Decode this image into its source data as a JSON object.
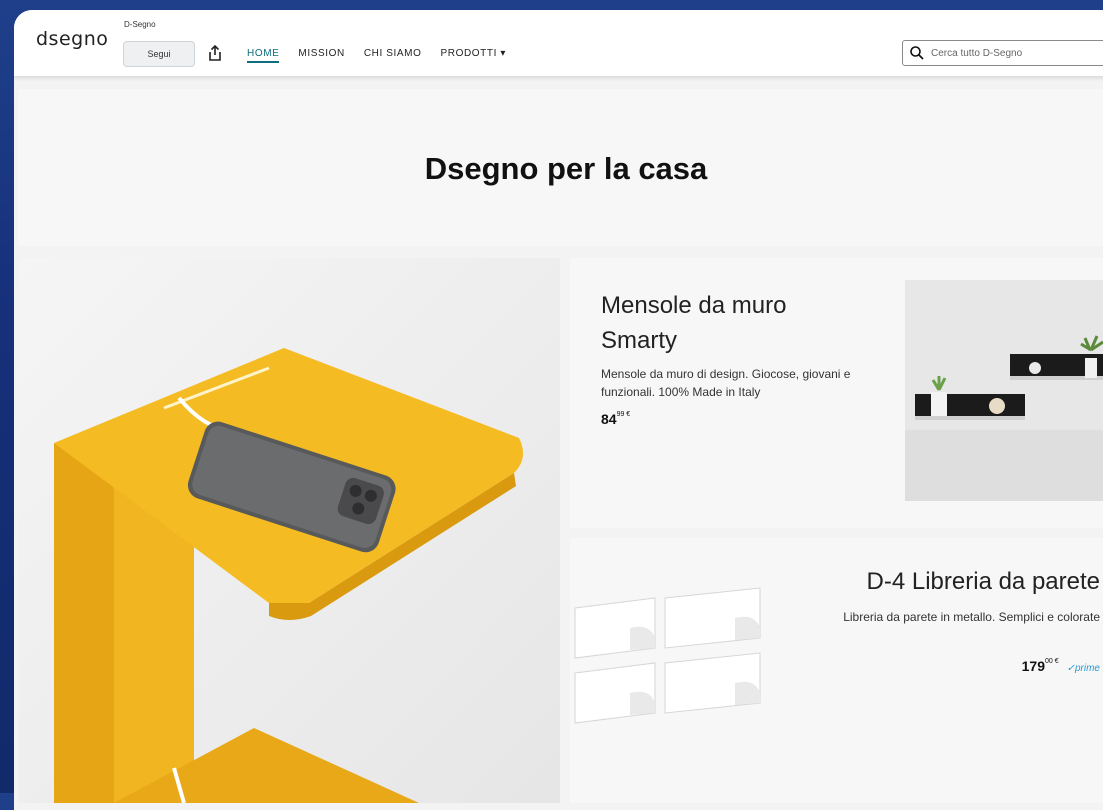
{
  "header": {
    "logo": "dsegno",
    "brand": "D-Segno",
    "follow_label": "Segui",
    "nav": [
      {
        "label": "HOME",
        "active": true
      },
      {
        "label": "MISSION",
        "active": false
      },
      {
        "label": "CHI SIAMO",
        "active": false
      },
      {
        "label": "PRODOTTI ▾",
        "active": false
      }
    ],
    "search_placeholder": "Cerca tutto D-Segno"
  },
  "hero": {
    "title": "Dsegno per la casa"
  },
  "products": [
    {
      "title": "Mensole da muro Smarty",
      "description": "Mensole da muro di design. Giocose, giovani e funzionali. 100% Made in Italy",
      "price_whole": "84",
      "price_cents": "99 €",
      "prime": ""
    },
    {
      "title": "D-4 Libreria da parete",
      "description": "Libreria da parete in metallo. Semplici e colorate",
      "price_whole": "179",
      "price_cents": "00 €",
      "prime": "✓prime"
    }
  ],
  "colors": {
    "accent": "#0b6e7a",
    "product_yellow": "#f2b51f",
    "frame": "#1f3f8a"
  }
}
